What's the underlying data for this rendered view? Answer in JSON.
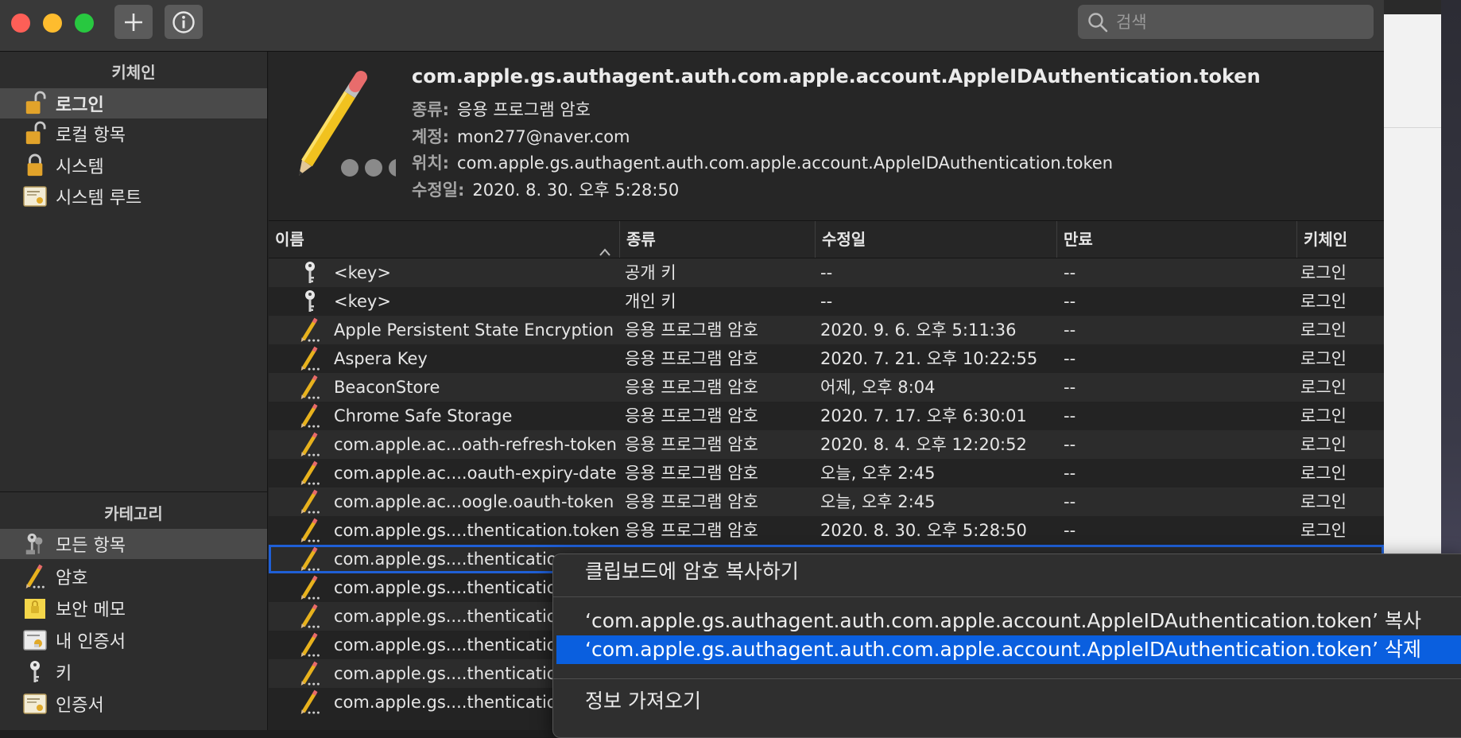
{
  "toolbar": {
    "search_placeholder": "검색",
    "add_label": "+",
    "info_label": "i"
  },
  "sidebar": {
    "keychains_title": "키체인",
    "keychains": [
      {
        "label": "로그인",
        "icon": "lock-open-icon",
        "selected": true
      },
      {
        "label": "로컬 항목",
        "icon": "lock-open-icon",
        "selected": false
      },
      {
        "label": "시스템",
        "icon": "lock-closed-icon",
        "selected": false
      },
      {
        "label": "시스템 루트",
        "icon": "certificate-icon",
        "selected": false
      }
    ],
    "category_title": "카테고리",
    "categories": [
      {
        "label": "모든 항목",
        "icon": "keys-icon",
        "selected": true
      },
      {
        "label": "암호",
        "icon": "pencil-icon",
        "selected": false
      },
      {
        "label": "보안 메모",
        "icon": "secure-note-icon",
        "selected": false
      },
      {
        "label": "내 인증서",
        "icon": "my-certificate-icon",
        "selected": false
      },
      {
        "label": "키",
        "icon": "key-icon",
        "selected": false
      },
      {
        "label": "인증서",
        "icon": "certificate-icon",
        "selected": false
      }
    ]
  },
  "detail": {
    "title": "com.apple.gs.authagent.auth.com.apple.account.AppleIDAuthentication.token",
    "kind_label": "종류:",
    "kind_value": "응용 프로그램 암호",
    "account_label": "계정:",
    "account_value": "mon277@naver.com",
    "where_label": "위치:",
    "where_value": "com.apple.gs.authagent.auth.com.apple.account.AppleIDAuthentication.token",
    "modified_label": "수정일:",
    "modified_value": "2020. 8. 30. 오후 5:28:50"
  },
  "table": {
    "headers": {
      "name": "이름",
      "kind": "종류",
      "modified": "수정일",
      "expires": "만료",
      "keychain": "키체인"
    },
    "rows": [
      {
        "icon": "key-icon",
        "name": "<key>",
        "kind": "공개 키",
        "modified": "--",
        "expires": "--",
        "keychain": "로그인"
      },
      {
        "icon": "key-icon",
        "name": "<key>",
        "kind": "개인 키",
        "modified": "--",
        "expires": "--",
        "keychain": "로그인"
      },
      {
        "icon": "pencil-icon",
        "name": "Apple Persistent State Encryption",
        "kind": "응용 프로그램 암호",
        "modified": "2020. 9. 6. 오후 5:11:36",
        "expires": "--",
        "keychain": "로그인"
      },
      {
        "icon": "pencil-icon",
        "name": "Aspera Key",
        "kind": "응용 프로그램 암호",
        "modified": "2020. 7. 21. 오후 10:22:55",
        "expires": "--",
        "keychain": "로그인"
      },
      {
        "icon": "pencil-icon",
        "name": "BeaconStore",
        "kind": "응용 프로그램 암호",
        "modified": "어제, 오후 8:04",
        "expires": "--",
        "keychain": "로그인"
      },
      {
        "icon": "pencil-icon",
        "name": "Chrome Safe Storage",
        "kind": "응용 프로그램 암호",
        "modified": "2020. 7. 17. 오후 6:30:01",
        "expires": "--",
        "keychain": "로그인"
      },
      {
        "icon": "pencil-icon",
        "name": "com.apple.ac...oath-refresh-token",
        "kind": "응용 프로그램 암호",
        "modified": "2020. 8. 4. 오후 12:20:52",
        "expires": "--",
        "keychain": "로그인"
      },
      {
        "icon": "pencil-icon",
        "name": "com.apple.ac....oauth-expiry-date",
        "kind": "응용 프로그램 암호",
        "modified": "오늘, 오후 2:45",
        "expires": "--",
        "keychain": "로그인"
      },
      {
        "icon": "pencil-icon",
        "name": "com.apple.ac...oogle.oauth-token",
        "kind": "응용 프로그램 암호",
        "modified": "오늘, 오후 2:45",
        "expires": "--",
        "keychain": "로그인"
      },
      {
        "icon": "pencil-icon",
        "name": "com.apple.gs....thentication.token",
        "kind": "응용 프로그램 암호",
        "modified": "2020. 8. 30. 오후 5:28:50",
        "expires": "--",
        "keychain": "로그인"
      },
      {
        "icon": "pencil-icon",
        "name": "com.apple.gs....thenticatio",
        "kind": "",
        "modified": "",
        "expires": "",
        "keychain": ""
      },
      {
        "icon": "pencil-icon",
        "name": "com.apple.gs....thentication",
        "kind": "",
        "modified": "",
        "expires": "",
        "keychain": ""
      },
      {
        "icon": "pencil-icon",
        "name": "com.apple.gs....thentication",
        "kind": "",
        "modified": "",
        "expires": "",
        "keychain": ""
      },
      {
        "icon": "pencil-icon",
        "name": "com.apple.gs....thentication",
        "kind": "",
        "modified": "",
        "expires": "",
        "keychain": ""
      },
      {
        "icon": "pencil-icon",
        "name": "com.apple.gs....thentication",
        "kind": "",
        "modified": "",
        "expires": "",
        "keychain": ""
      },
      {
        "icon": "pencil-icon",
        "name": "com.apple.gs....thentication",
        "kind": "",
        "modified": "",
        "expires": "",
        "keychain": ""
      }
    ]
  },
  "context_menu": {
    "copy_password": "클립보드에 암호 복사하기",
    "copy_item": "‘com.apple.gs.authagent.auth.com.apple.account.AppleIDAuthentication.token’ 복사",
    "delete_item": "‘com.apple.gs.authagent.auth.com.apple.account.AppleIDAuthentication.token’ 삭제",
    "get_info": "정보 가져오기"
  },
  "colors": {
    "highlight": "#0a5fdf",
    "focus_ring": "#1f5fd6",
    "close": "#fe5f57",
    "minimize": "#febc2e",
    "zoom": "#28c840"
  }
}
